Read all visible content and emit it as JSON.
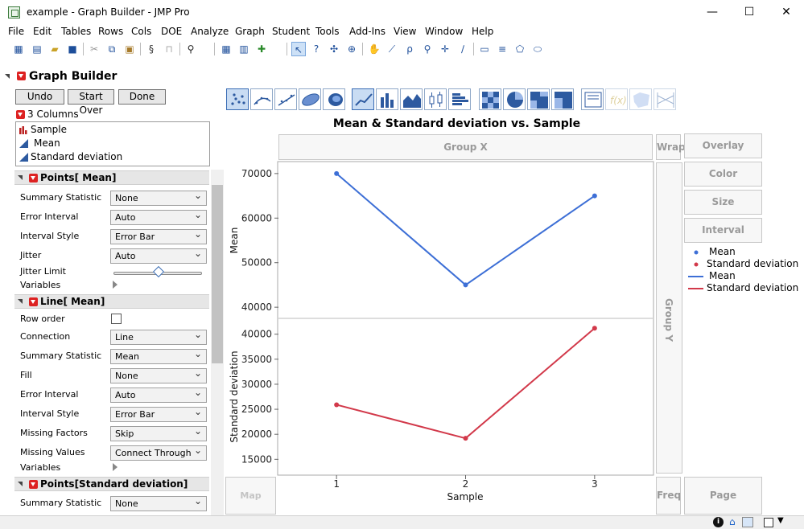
{
  "window": {
    "title": "example - Graph Builder - JMP Pro",
    "minimize": "—",
    "maximize": "☐",
    "close": "✕"
  },
  "menu": [
    "File",
    "Edit",
    "Tables",
    "Rows",
    "Cols",
    "DOE",
    "Analyze",
    "Graph",
    "Student",
    "Tools",
    "Add-Ins",
    "View",
    "Window",
    "Help"
  ],
  "graph_builder": {
    "title": "Graph Builder"
  },
  "buttons": {
    "undo": "Undo",
    "start_over": "Start Over",
    "done": "Done"
  },
  "columns": {
    "header": "3 Columns",
    "items": [
      "Sample",
      "Mean",
      "Standard deviation"
    ]
  },
  "sections": {
    "points_mean": {
      "title": "Points[ Mean]",
      "rows": [
        {
          "label": "Summary Statistic",
          "value": "None"
        },
        {
          "label": "Error Interval",
          "value": "Auto"
        },
        {
          "label": "Interval Style",
          "value": "Error Bar"
        },
        {
          "label": "Jitter",
          "value": "Auto"
        }
      ],
      "jitter_limit": "Jitter Limit",
      "variables": "Variables"
    },
    "line_mean": {
      "title": "Line[ Mean]",
      "row_order": "Row order",
      "rows": [
        {
          "label": "Connection",
          "value": "Line"
        },
        {
          "label": "Summary Statistic",
          "value": "Mean"
        },
        {
          "label": "Fill",
          "value": "None"
        },
        {
          "label": "Error Interval",
          "value": "Auto"
        },
        {
          "label": "Interval Style",
          "value": "Error Bar"
        },
        {
          "label": "Missing Factors",
          "value": "Skip"
        },
        {
          "label": "Missing Values",
          "value": "Connect Through"
        }
      ],
      "variables": "Variables"
    },
    "points_sd": {
      "title": "Points[Standard deviation]",
      "rows": [
        {
          "label": "Summary Statistic",
          "value": "None"
        }
      ]
    }
  },
  "zones": {
    "group_x": "Group X",
    "wrap": "Wrap",
    "overlay": "Overlay",
    "color": "Color",
    "size": "Size",
    "interval": "Interval",
    "group_y": "Group Y",
    "map_shape": "Map Shape",
    "freq": "Freq",
    "page": "Page"
  },
  "colors": {
    "mean": "#3d6fd6",
    "sd": "#d2394a"
  },
  "chart_data": {
    "type": "line",
    "title": "Mean & Standard deviation vs. Sample",
    "xlabel": "Sample",
    "x": [
      1,
      2,
      3
    ],
    "panels": [
      {
        "ylabel": "Mean",
        "series": [
          {
            "name": "Mean",
            "values": [
              70000,
              45000,
              65000
            ]
          }
        ],
        "ylim": [
          37500,
          72500
        ],
        "yticks": [
          40000,
          50000,
          60000,
          70000
        ]
      },
      {
        "ylabel": "Standard deviation",
        "series": [
          {
            "name": "Standard deviation",
            "values": [
              25900,
              19200,
              41200
            ]
          }
        ],
        "ylim": [
          12000,
          43000
        ],
        "yticks": [
          15000,
          20000,
          25000,
          30000,
          35000,
          40000
        ]
      }
    ],
    "legend": {
      "placement": "right",
      "entries": [
        {
          "label": "Mean",
          "kind": "point"
        },
        {
          "label": "Standard deviation",
          "kind": "point"
        },
        {
          "label": "Mean",
          "kind": "line"
        },
        {
          "label": "Standard deviation",
          "kind": "line"
        }
      ]
    }
  }
}
